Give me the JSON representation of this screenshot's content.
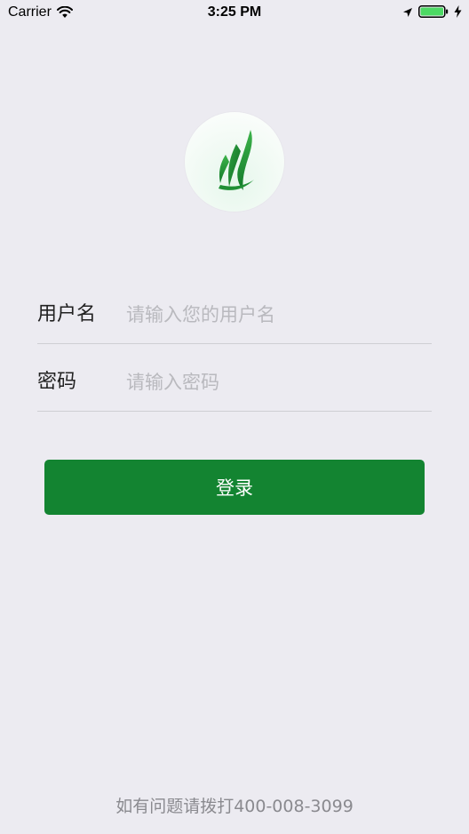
{
  "status_bar": {
    "carrier": "Carrier",
    "time": "3:25 PM",
    "icons": [
      "wifi-icon",
      "location-icon",
      "battery-icon",
      "charging-icon"
    ]
  },
  "logo": {
    "icon": "leaf-logo-icon",
    "colors": {
      "dark_green": "#137a2a",
      "light_green": "#3fb34f"
    }
  },
  "form": {
    "username": {
      "label": "用户名",
      "placeholder": "请输入您的用户名",
      "value": ""
    },
    "password": {
      "label": "密码",
      "placeholder": "请输入密码",
      "value": ""
    }
  },
  "login_button": {
    "label": "登录",
    "color": "#138431"
  },
  "footer": {
    "text": "如有问题请拨打400-008-3099"
  }
}
